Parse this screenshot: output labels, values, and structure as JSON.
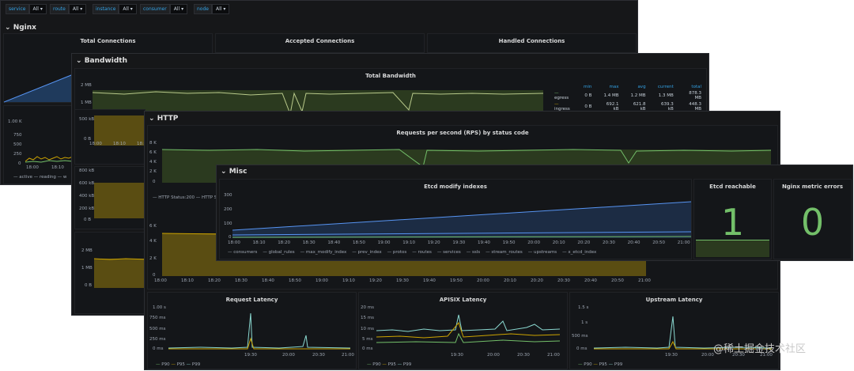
{
  "vars": [
    {
      "key": "service",
      "value": "All"
    },
    {
      "key": "route",
      "value": "All"
    },
    {
      "key": "instance",
      "value": "All"
    },
    {
      "key": "consumer",
      "value": "All"
    },
    {
      "key": "node",
      "value": "All"
    }
  ],
  "rows": {
    "nginx": "Nginx",
    "bandwidth": "Bandwidth",
    "http": "HTTP",
    "misc": "Misc"
  },
  "nginx": {
    "total_connections": "Total Connections",
    "accepted_connections": "Accepted Connections",
    "handled_connections": "Handled Connections",
    "y_ticks": [
      "1.00 K",
      "750",
      "500",
      "250",
      "0"
    ],
    "x_ticks": [
      "18:00",
      "18:10"
    ],
    "legend": [
      "active",
      "reading",
      "w"
    ]
  },
  "bandwidth": {
    "title": "Total Bandwidth",
    "y_ticks": [
      "2 MB",
      "1 MB",
      "500 kB",
      "0 B"
    ],
    "x_ticks": [
      "18:00",
      "18:10",
      "18:2"
    ],
    "left_y_ticks_2": [
      "800 kB",
      "600 kB",
      "400 kB",
      "200 kB",
      "0 B"
    ],
    "left_y_ticks_3": [
      "2 MB",
      "1 MB",
      "0 B"
    ],
    "table_headers": [
      "min",
      "max",
      "avg",
      "current",
      "total"
    ],
    "table_rows": [
      {
        "name": "egress",
        "values": [
          "0 B",
          "1.4 MB",
          "1.2 MB",
          "1.3 MB",
          "878.3 MB"
        ]
      },
      {
        "name": "ingress",
        "values": [
          "0 B",
          "692.1 kB",
          "621.8 kB",
          "639.3 kB",
          "448.3 MB"
        ]
      }
    ]
  },
  "http": {
    "title": "Requests per second (RPS) by status code",
    "y_ticks": [
      "8 K",
      "6 K",
      "4 K",
      "2 K",
      "0"
    ],
    "legend": [
      "HTTP Status:200",
      "HTTP S"
    ],
    "y_ticks_2": [
      "6 K",
      "4 K",
      "2 K",
      "0"
    ],
    "x_ticks": [
      "18:00",
      "18:10",
      "18:20",
      "18:30",
      "18:40",
      "18:50",
      "19:00",
      "19:10",
      "19:20",
      "19:30",
      "19:40",
      "19:50",
      "20:00",
      "20:10",
      "20:20",
      "20:30",
      "20:40",
      "20:50",
      "21:00"
    ],
    "latency": [
      {
        "title": "Request Latency",
        "y_ticks": [
          "1.00 s",
          "750 ms",
          "500 ms",
          "250 ms",
          "0 ms"
        ],
        "x_ticks": [
          "19:30",
          "20:00",
          "20:30",
          "21:00"
        ]
      },
      {
        "title": "APISIX Latency",
        "y_ticks": [
          "20 ms",
          "15 ms",
          "10 ms",
          "5 ms",
          "0 ms"
        ],
        "x_ticks": [
          "19:30",
          "20:00",
          "20:30",
          "21:00"
        ]
      },
      {
        "title": "Upstream Latency",
        "y_ticks": [
          "1.5 s",
          "1 s",
          "500 ms",
          "0 ms"
        ],
        "x_ticks": [
          "19:30",
          "20:00",
          "20:30",
          "21:00"
        ]
      }
    ],
    "latency_legend": [
      "P90",
      "P95",
      "P99"
    ]
  },
  "misc": {
    "etcd_title": "Etcd modify indexes",
    "y_ticks": [
      "300",
      "200",
      "100",
      "0"
    ],
    "x_ticks": [
      "18:00",
      "18:10",
      "18:20",
      "18:30",
      "18:40",
      "18:50",
      "19:00",
      "19:10",
      "19:20",
      "19:30",
      "19:40",
      "19:50",
      "20:00",
      "20:10",
      "20:20",
      "20:30",
      "20:40",
      "20:50",
      "21:00"
    ],
    "legend": [
      "consumers",
      "global_rules",
      "max_modify_index",
      "prev_index",
      "protos",
      "routes",
      "services",
      "ssls",
      "stream_routes",
      "upstreams",
      "x_etcd_index"
    ],
    "etcd_reachable_title": "Etcd reachable",
    "etcd_reachable_value": "1",
    "nginx_errors_title": "Nginx metric errors",
    "nginx_errors_value": "0"
  },
  "watermark": "@稀土掘金技术社区",
  "colors": {
    "green": "#73bf69",
    "yellow": "#cca300",
    "blue": "#33a2e5",
    "bg": "#161719"
  }
}
